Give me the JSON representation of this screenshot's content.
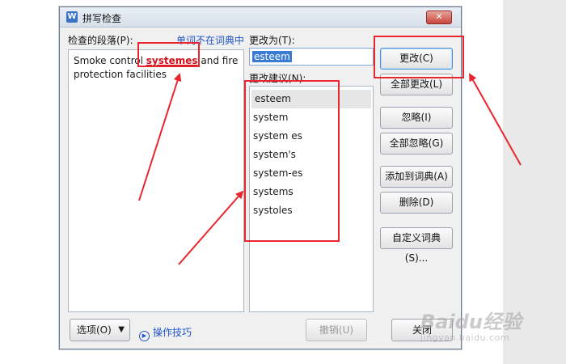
{
  "dialog": {
    "title": "拼写检查",
    "close_icon": "close-icon",
    "app_icon_letter": "W"
  },
  "labels": {
    "paragraph": "检查的段落(P):",
    "not_in_dict": "单词不在词典中",
    "change_to": "更改为(T):",
    "suggestions": "更改建议(N):"
  },
  "paragraph": {
    "before": "Smoke control ",
    "error_word": "systemes",
    "after": " and fire protection facilities"
  },
  "change_to_value": "esteem",
  "suggestions": [
    "esteem",
    "system",
    "system es",
    "system's",
    "system-es",
    "systems",
    "systoles"
  ],
  "buttons": {
    "change": "更改(C)",
    "change_all": "全部更改(L)",
    "ignore": "忽略(I)",
    "ignore_all": "全部忽略(G)",
    "add_to_dict": "添加到词典(A)",
    "delete": "删除(D)",
    "custom_dict": "自定义词典(S)...",
    "options": "选项(O)",
    "undo": "撤销(U)",
    "close": "关闭"
  },
  "tips_link": "操作技巧",
  "watermark": {
    "brand": "Baidu经验",
    "url": "jingyan.baidu.com"
  },
  "colors": {
    "annotation_red": "#e8262d",
    "link_blue": "#1f55c9",
    "error_red": "#d1121b"
  }
}
